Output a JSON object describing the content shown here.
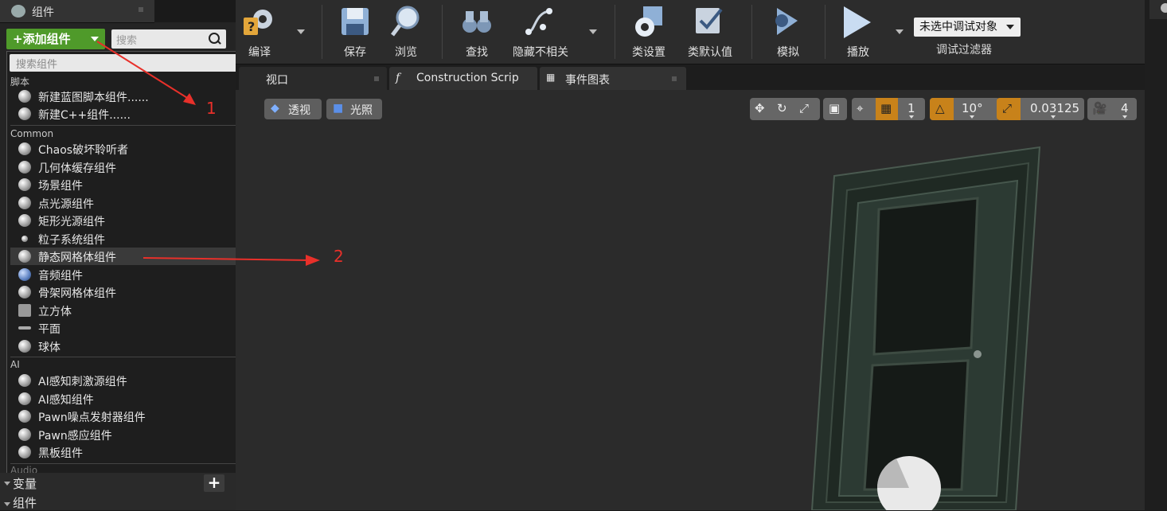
{
  "panel": {
    "tab_title": "组件",
    "add_button_label": "添加组件",
    "search_placeholder": "搜索",
    "dropdown_search_placeholder": "搜索组件",
    "categories": {
      "script": "脚本",
      "common": "Common",
      "ai": "AI",
      "audio": "Audio"
    },
    "script_items": [
      "新建蓝图脚本组件......",
      "新建C++组件......"
    ],
    "common_items": [
      "Chaos破坏聆听者",
      "几何体缓存组件",
      "场景组件",
      "点光源组件",
      "矩形光源组件",
      "粒子系统组件",
      "静态网格体组件",
      "音频组件",
      "骨架网格体组件",
      "立方体",
      "平面",
      "球体"
    ],
    "ai_items": [
      "AI感知刺激源组件",
      "AI感知组件",
      "Pawn噪点发射器组件",
      "Pawn感应组件",
      "黑板组件"
    ],
    "selected_item": "静态网格体组件",
    "bottom_sections": [
      "变量",
      "组件"
    ]
  },
  "toolbar": {
    "compile": "编译",
    "save": "保存",
    "browse": "浏览",
    "find": "查找",
    "hide_unrelated": "隐藏不相关",
    "class_settings": "类设置",
    "class_defaults": "类默认值",
    "simulate": "模拟",
    "play": "播放",
    "debug_object": "未选中调试对象",
    "debug_filter": "调试过滤器"
  },
  "tabs": [
    "视口",
    "Construction Scrip",
    "事件图表"
  ],
  "viewport": {
    "perspective": "透视",
    "lit": "光照",
    "grid_size": "1",
    "rotation_snap": "10°",
    "scale_snap": "0.03125",
    "camera_speed": "4"
  },
  "annotations": [
    "1",
    "2"
  ],
  "colors": {
    "add_button": "#4f9a2a",
    "annotation_red": "#e8302a",
    "snap_orange": "#c8821a",
    "door_green": "#2c3a33"
  }
}
